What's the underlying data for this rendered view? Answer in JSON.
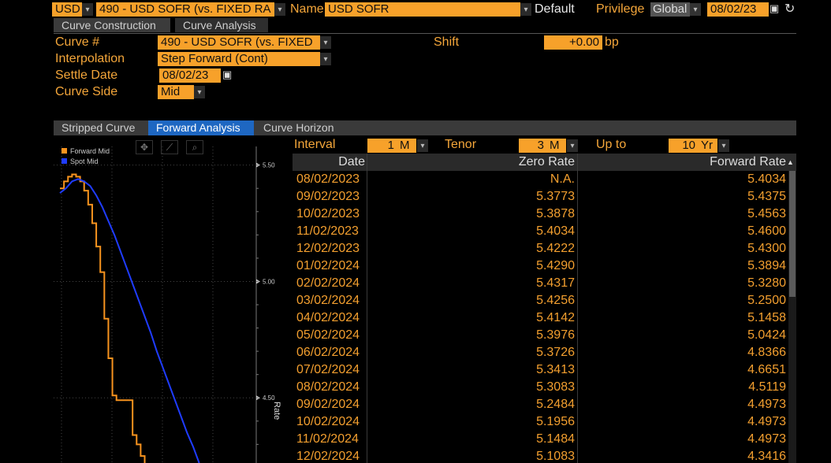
{
  "header": {
    "currency": "USD",
    "curve_selector": "490 - USD SOFR (vs. FIXED RA",
    "name_label": "Name",
    "name_value": "USD SOFR",
    "default_label": "Default",
    "privilege_label": "Privilege",
    "privilege_value": "Global",
    "date": "08/02/23"
  },
  "top_tabs": [
    {
      "label": "Curve Construction"
    },
    {
      "label": "Curve Analysis"
    }
  ],
  "form": {
    "curve_num_label": "Curve #",
    "curve_num_value": "490 - USD SOFR (vs. FIXED",
    "interpolation_label": "Interpolation",
    "interpolation_value": "Step Forward (Cont)",
    "settle_date_label": "Settle Date",
    "settle_date_value": "08/02/23",
    "curve_side_label": "Curve Side",
    "curve_side_value": "Mid",
    "shift_label": "Shift",
    "shift_value": "+0.00",
    "shift_unit": "bp"
  },
  "sub_tabs": [
    {
      "label": "Stripped Curve"
    },
    {
      "label": "Forward Analysis"
    },
    {
      "label": "Curve Horizon"
    }
  ],
  "controls": {
    "interval_label": "Interval",
    "interval_value": "1",
    "interval_unit": "M",
    "tenor_label": "Tenor",
    "tenor_value": "3",
    "tenor_unit": "M",
    "upto_label": "Up to",
    "upto_value": "10",
    "upto_unit": "Yr"
  },
  "legend": [
    {
      "name": "Forward Mid",
      "color": "#f7931e"
    },
    {
      "name": "Spot Mid",
      "color": "#1f3cff"
    }
  ],
  "chart_data": {
    "type": "line",
    "ylabel": "Rate",
    "y_ticks": [
      "5.50",
      "5.00",
      "4.50"
    ],
    "ylim": [
      4.22,
      5.58
    ],
    "series": [
      {
        "name": "Forward Mid",
        "color": "#f7931e",
        "x": [
          0,
          0.02,
          0.04,
          0.06,
          0.08,
          0.1,
          0.12,
          0.14,
          0.16,
          0.18,
          0.2,
          0.22,
          0.24,
          0.26,
          0.28,
          0.3,
          0.32,
          0.34,
          0.36,
          0.38,
          0.4,
          0.42
        ],
        "values": [
          5.4,
          5.43,
          5.45,
          5.46,
          5.45,
          5.43,
          5.39,
          5.33,
          5.25,
          5.15,
          5.04,
          4.84,
          4.67,
          4.51,
          4.49,
          4.49,
          4.49,
          4.49,
          4.34,
          4.3,
          4.25,
          4.2
        ]
      },
      {
        "name": "Spot Mid",
        "color": "#1f3cff",
        "x": [
          0,
          0.03,
          0.06,
          0.09,
          0.12,
          0.15,
          0.18,
          0.21,
          0.24,
          0.27,
          0.3,
          0.33,
          0.36,
          0.39,
          0.42,
          0.45,
          0.48,
          0.51,
          0.54,
          0.57,
          0.6,
          0.63,
          0.66,
          0.69
        ],
        "values": [
          5.38,
          5.4,
          5.43,
          5.44,
          5.43,
          5.41,
          5.37,
          5.32,
          5.26,
          5.2,
          5.13,
          5.06,
          4.99,
          4.92,
          4.85,
          4.78,
          4.7,
          4.63,
          4.56,
          4.49,
          4.42,
          4.35,
          4.29,
          4.22
        ]
      }
    ]
  },
  "table": {
    "columns": [
      "Date",
      "Zero Rate",
      "Forward Rate"
    ],
    "rows": [
      [
        "08/02/2023",
        "N.A.",
        "5.4034"
      ],
      [
        "09/02/2023",
        "5.3773",
        "5.4375"
      ],
      [
        "10/02/2023",
        "5.3878",
        "5.4563"
      ],
      [
        "11/02/2023",
        "5.4034",
        "5.4600"
      ],
      [
        "12/02/2023",
        "5.4222",
        "5.4300"
      ],
      [
        "01/02/2024",
        "5.4290",
        "5.3894"
      ],
      [
        "02/02/2024",
        "5.4317",
        "5.3280"
      ],
      [
        "03/02/2024",
        "5.4256",
        "5.2500"
      ],
      [
        "04/02/2024",
        "5.4142",
        "5.1458"
      ],
      [
        "05/02/2024",
        "5.3976",
        "5.0424"
      ],
      [
        "06/02/2024",
        "5.3726",
        "4.8366"
      ],
      [
        "07/02/2024",
        "5.3413",
        "4.6651"
      ],
      [
        "08/02/2024",
        "5.3083",
        "4.5119"
      ],
      [
        "09/02/2024",
        "5.2484",
        "4.4973"
      ],
      [
        "10/02/2024",
        "5.1956",
        "4.4973"
      ],
      [
        "11/02/2024",
        "5.1484",
        "4.4973"
      ],
      [
        "12/02/2024",
        "5.1083",
        "4.3416"
      ]
    ]
  }
}
